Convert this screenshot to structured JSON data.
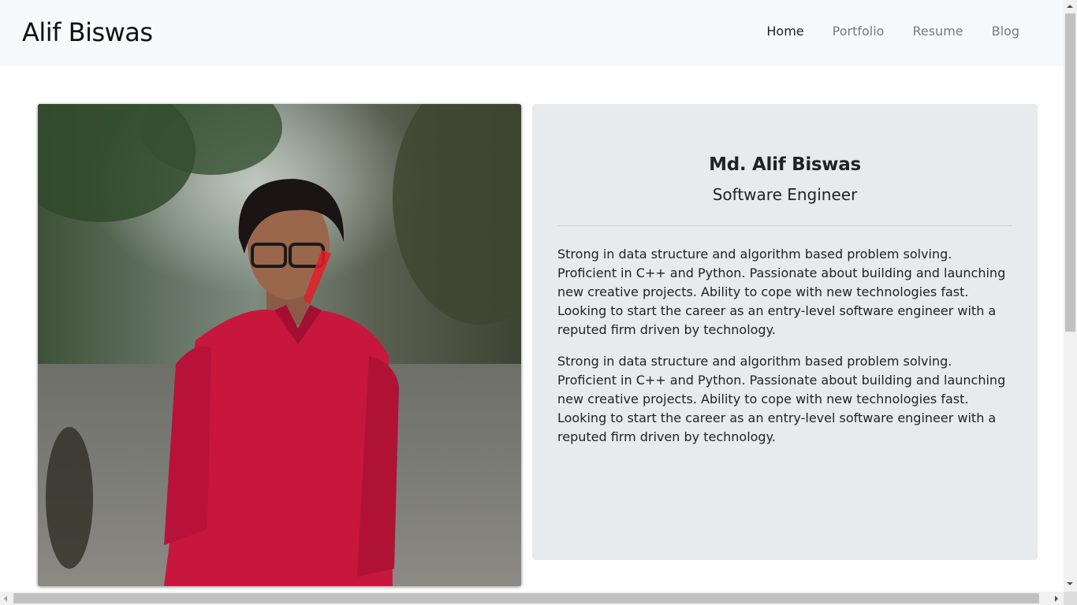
{
  "header": {
    "brand": "Alif Biswas",
    "nav": [
      {
        "label": "Home",
        "active": true
      },
      {
        "label": "Portfolio",
        "active": false
      },
      {
        "label": "Resume",
        "active": false
      },
      {
        "label": "Blog",
        "active": false
      }
    ]
  },
  "profile": {
    "name": "Md. Alif Biswas",
    "role": "Software Engineer",
    "bio": [
      "Strong in data structure and algorithm based problem solving. Proficient in C++ and Python. Passionate about building and launching new creative projects. Ability to cope with new technologies fast. Looking to start the career as an entry-level software engineer with a reputed firm driven by technology.",
      "Strong in data structure and algorithm based problem solving. Proficient in C++ and Python. Passionate about building and launching new creative projects. Ability to cope with new technologies fast. Looking to start the career as an entry-level software engineer with a reputed firm driven by technology."
    ],
    "photo_icon": "profile-photo"
  },
  "colors": {
    "navbar_bg": "#f8f9fa",
    "card_bg": "#e8ebee",
    "shirt": "#c8173c",
    "active_link": "#222222",
    "inactive_link": "#7a7a7a"
  }
}
